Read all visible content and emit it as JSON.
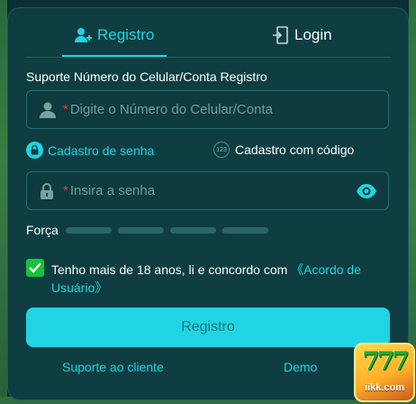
{
  "tabs": {
    "register_label": "Registro",
    "login_label": "Login"
  },
  "form": {
    "account_label": "Suporte Número do Celular/Conta Registro",
    "account_placeholder_required": "*",
    "account_placeholder": "Digite o Número do Celular/Conta",
    "password_placeholder_required": "*",
    "password_placeholder": "Insira a senha",
    "strength_label": "Força",
    "strength_level": 0
  },
  "modes": {
    "password_mode_label": "Cadastro de senha",
    "code_mode_badge": "123",
    "code_mode_label": "Cadastro com código"
  },
  "terms": {
    "checked": true,
    "text": "Tenho mais de 18 anos, li e concordo com ",
    "link": "《Acordo de Usuário》"
  },
  "actions": {
    "submit_label": "Registro",
    "support_link": "Suporte ao cliente",
    "demo_link": "Demo"
  },
  "logo": {
    "sevens": "777",
    "site": "iikk.com"
  },
  "colors": {
    "accent": "#20d4e2",
    "panel": "#0e3e42",
    "check": "#17c13b"
  }
}
